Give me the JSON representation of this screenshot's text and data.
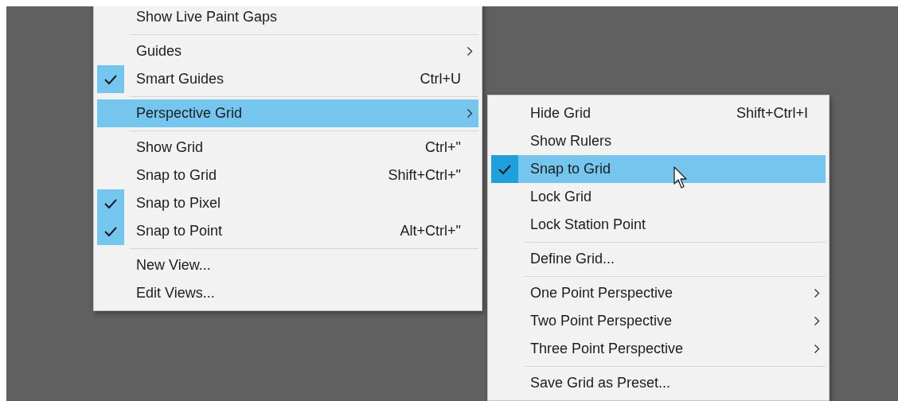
{
  "menus": [
    {
      "items": [
        {
          "kind": "item",
          "label": "Show Live Paint Gaps",
          "checked": false,
          "selected": false
        },
        {
          "kind": "separator"
        },
        {
          "kind": "item",
          "label": "Guides",
          "checked": false,
          "selected": false,
          "submenu": true
        },
        {
          "kind": "item",
          "label": "Smart Guides",
          "shortcut": "Ctrl+U",
          "checked": true,
          "selected": false
        },
        {
          "kind": "separator"
        },
        {
          "kind": "item",
          "label": "Perspective Grid",
          "checked": false,
          "selected": true,
          "submenu": true
        },
        {
          "kind": "separator"
        },
        {
          "kind": "item",
          "label": "Show Grid",
          "shortcut": "Ctrl+\"",
          "checked": false,
          "selected": false
        },
        {
          "kind": "item",
          "label": "Snap to Grid",
          "shortcut": "Shift+Ctrl+\"",
          "checked": false,
          "selected": false
        },
        {
          "kind": "item",
          "label": "Snap to Pixel",
          "checked": true,
          "selected": false
        },
        {
          "kind": "item",
          "label": "Snap to Point",
          "shortcut": "Alt+Ctrl+\"",
          "checked": true,
          "selected": false
        },
        {
          "kind": "separator"
        },
        {
          "kind": "item",
          "label": "New View...",
          "checked": false,
          "selected": false
        },
        {
          "kind": "item",
          "label": "Edit Views...",
          "checked": false,
          "selected": false
        }
      ]
    },
    {
      "items": [
        {
          "kind": "item",
          "label": "Hide Grid",
          "shortcut": "Shift+Ctrl+I",
          "checked": false,
          "selected": false
        },
        {
          "kind": "item",
          "label": "Show Rulers",
          "checked": false,
          "selected": false
        },
        {
          "kind": "item",
          "label": "Snap to Grid",
          "checked": true,
          "selected": true
        },
        {
          "kind": "item",
          "label": "Lock Grid",
          "checked": false,
          "selected": false
        },
        {
          "kind": "item",
          "label": "Lock Station Point",
          "checked": false,
          "selected": false
        },
        {
          "kind": "separator"
        },
        {
          "kind": "item",
          "label": "Define Grid...",
          "checked": false,
          "selected": false
        },
        {
          "kind": "separator"
        },
        {
          "kind": "item",
          "label": "One Point Perspective",
          "checked": false,
          "selected": false,
          "submenu": true
        },
        {
          "kind": "item",
          "label": "Two Point Perspective",
          "checked": false,
          "selected": false,
          "submenu": true
        },
        {
          "kind": "item",
          "label": "Three Point Perspective",
          "checked": false,
          "selected": false,
          "submenu": true
        },
        {
          "kind": "separator"
        },
        {
          "kind": "item",
          "label": "Save Grid as Preset...",
          "checked": false,
          "selected": false
        }
      ]
    }
  ]
}
